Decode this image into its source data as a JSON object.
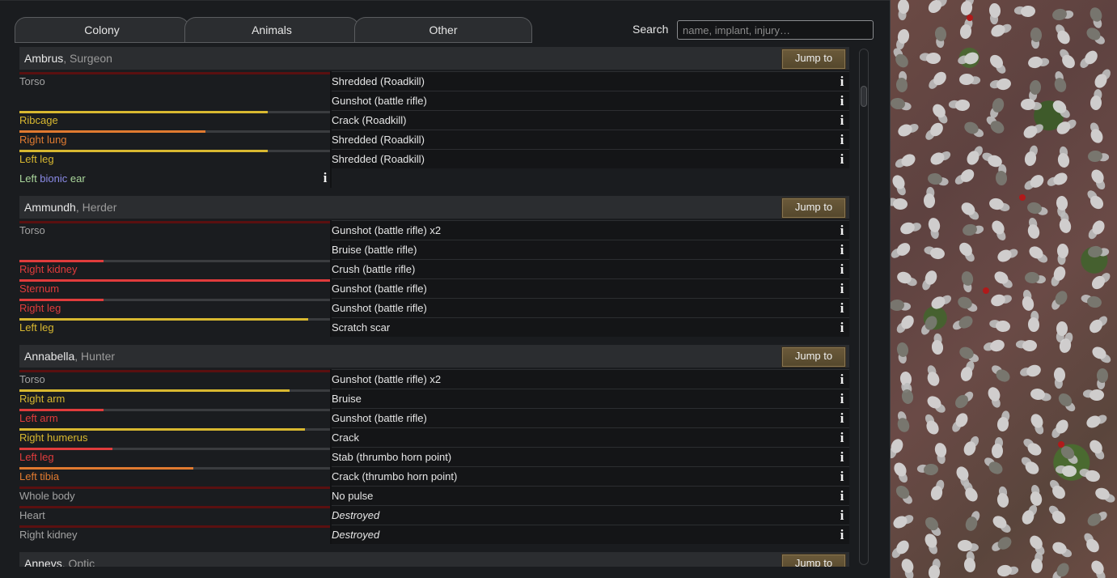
{
  "tabs": [
    "Colony",
    "Animals",
    "Other"
  ],
  "search": {
    "label": "Search",
    "placeholder": "name, implant, injury…"
  },
  "jump_label": "Jump to",
  "colors": {
    "yellow": "#d8b830",
    "orange": "#e07a30",
    "red": "#e03c3c",
    "gray": "#a2a2a2",
    "darkred": "#5a1010"
  },
  "pawns": [
    {
      "name": "Ambrus",
      "role": ", Surgeon",
      "rows": [
        {
          "part": "Torso",
          "part_color": "gray",
          "health": 0.0,
          "bar_color": "darkred",
          "hediff": "Shredded (Roadkill)",
          "hediff_style": "normal"
        },
        {
          "part": "",
          "part_color": "gray",
          "health": null,
          "bar_color": "",
          "hediff": "Gunshot (battle rifle)",
          "hediff_style": "normal"
        },
        {
          "part": "Ribcage",
          "part_color": "yellow",
          "health": 0.8,
          "bar_color": "yellow",
          "hediff": "Crack (Roadkill)",
          "hediff_style": "normal"
        },
        {
          "part": "Right lung",
          "part_color": "orange",
          "health": 0.6,
          "bar_color": "orange",
          "hediff": "Shredded (Roadkill)",
          "hediff_style": "normal"
        },
        {
          "part": "Left leg",
          "part_color": "yellow",
          "health": 0.8,
          "bar_color": "yellow",
          "hediff": "Shredded (Roadkill)",
          "hediff_style": "normal"
        }
      ],
      "implant": {
        "prefix": "Left ",
        "word": "bionic",
        "suffix": " ear"
      }
    },
    {
      "name": "Ammundh",
      "role": ", Herder",
      "rows": [
        {
          "part": "Torso",
          "part_color": "gray",
          "health": 0.0,
          "bar_color": "darkred",
          "hediff": "Gunshot (battle rifle) x2",
          "hediff_style": "normal"
        },
        {
          "part": "",
          "part_color": "gray",
          "health": null,
          "bar_color": "",
          "hediff": "Bruise (battle rifle)",
          "hediff_style": "normal"
        },
        {
          "part": "Right kidney",
          "part_color": "red",
          "health": 0.27,
          "bar_color": "red",
          "hediff": "Crush (battle rifle)",
          "hediff_style": "normal"
        },
        {
          "part": "Sternum",
          "part_color": "red",
          "health": 0.0,
          "bar_color": "red",
          "hediff": "Gunshot (battle rifle)",
          "hediff_style": "normal"
        },
        {
          "part": "Right leg",
          "part_color": "red",
          "health": 0.27,
          "bar_color": "red",
          "hediff": "Gunshot (battle rifle)",
          "hediff_style": "normal"
        },
        {
          "part": "Left leg",
          "part_color": "yellow",
          "health": 0.93,
          "bar_color": "yellow",
          "hediff": "Scratch scar",
          "hediff_style": "scar"
        }
      ]
    },
    {
      "name": "Annabella",
      "role": ", Hunter",
      "rows": [
        {
          "part": "Torso",
          "part_color": "gray",
          "health": 0.0,
          "bar_color": "darkred",
          "hediff": "Gunshot (battle rifle) x2",
          "hediff_style": "normal"
        },
        {
          "part": "Right arm",
          "part_color": "yellow",
          "health": 0.87,
          "bar_color": "yellow",
          "hediff": "Bruise",
          "hediff_style": "normal"
        },
        {
          "part": "Left arm",
          "part_color": "red",
          "health": 0.27,
          "bar_color": "red",
          "hediff": "Gunshot (battle rifle)",
          "hediff_style": "normal"
        },
        {
          "part": "Right humerus",
          "part_color": "yellow",
          "health": 0.92,
          "bar_color": "yellow",
          "hediff": "Crack",
          "hediff_style": "normal"
        },
        {
          "part": "Left leg",
          "part_color": "red",
          "health": 0.3,
          "bar_color": "red",
          "hediff": "Stab (thrumbo horn point)",
          "hediff_style": "normal"
        },
        {
          "part": "Left tibia",
          "part_color": "orange",
          "health": 0.56,
          "bar_color": "orange",
          "hediff": "Crack (thrumbo horn point)",
          "hediff_style": "normal"
        },
        {
          "part": "Whole body",
          "part_color": "gray",
          "health": 0.0,
          "bar_color": "darkred",
          "hediff": "No pulse",
          "hediff_style": "red"
        },
        {
          "part": "Heart",
          "part_color": "gray",
          "health": 0.0,
          "bar_color": "darkred",
          "hediff": "Destroyed",
          "hediff_style": "destroyed"
        },
        {
          "part": "Right kidney",
          "part_color": "gray",
          "health": 0.0,
          "bar_color": "darkred",
          "hediff": "Destroyed",
          "hediff_style": "destroyed"
        }
      ]
    },
    {
      "name": "Annevs",
      "role": ", Optic",
      "rows": []
    }
  ]
}
